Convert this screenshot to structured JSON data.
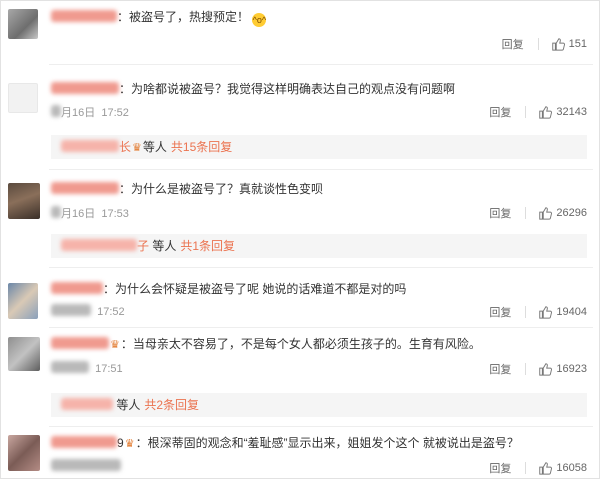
{
  "comments": [
    {
      "text": "：被盗号了，热搜预定！",
      "emoji": "😆",
      "reply_label": "回复",
      "like_count": "151"
    },
    {
      "text": "：为啥都说被盗号？我觉得这样明确表达自己的观点没有问题啊",
      "time": "17:52",
      "date_fragment": "月16日",
      "reply_label": "回复",
      "like_count": "32143",
      "sub": {
        "name_suffix": "长",
        "vip_mark": "♛",
        "others": "等人",
        "link": "共15条回复"
      }
    },
    {
      "text": "：为什么是被盗号了？真就谈性色变呗",
      "time": "17:53",
      "date_fragment": "月16日",
      "reply_label": "回复",
      "like_count": "26296",
      "sub": {
        "name_suffix": "子",
        "others": "等人",
        "link": "共1条回复"
      }
    },
    {
      "text": "：为什么会怀疑是被盗号了呢 她说的话难道不都是对的吗",
      "time": "17:52",
      "reply_label": "回复",
      "like_count": "19404"
    },
    {
      "text": "：当母亲太不容易了，不是每个女人都必须生孩子的。生育有风险。",
      "vip_mark": "♛",
      "time": "17:51",
      "reply_label": "回复",
      "like_count": "16923",
      "sub": {
        "others": "等人",
        "link": "共2条回复"
      }
    },
    {
      "text": "：根深蒂固的观念和“羞耻感”显示出来，姐姐发个这个 就被说出是盗号？",
      "name_suffix": "9",
      "vip_mark": "♛",
      "reply_label": "回复",
      "like_count": "16058"
    }
  ]
}
